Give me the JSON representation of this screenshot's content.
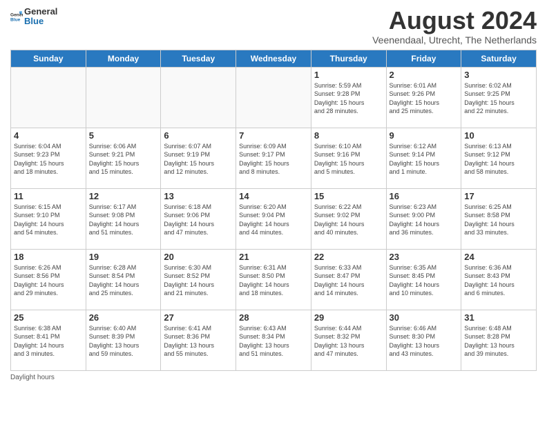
{
  "header": {
    "logo_general": "General",
    "logo_blue": "Blue",
    "month_title": "August 2024",
    "location": "Veenendaal, Utrecht, The Netherlands"
  },
  "weekdays": [
    "Sunday",
    "Monday",
    "Tuesday",
    "Wednesday",
    "Thursday",
    "Friday",
    "Saturday"
  ],
  "footer": {
    "label": "Daylight hours"
  },
  "weeks": [
    [
      {
        "day": "",
        "info": ""
      },
      {
        "day": "",
        "info": ""
      },
      {
        "day": "",
        "info": ""
      },
      {
        "day": "",
        "info": ""
      },
      {
        "day": "1",
        "info": "Sunrise: 5:59 AM\nSunset: 9:28 PM\nDaylight: 15 hours\nand 28 minutes."
      },
      {
        "day": "2",
        "info": "Sunrise: 6:01 AM\nSunset: 9:26 PM\nDaylight: 15 hours\nand 25 minutes."
      },
      {
        "day": "3",
        "info": "Sunrise: 6:02 AM\nSunset: 9:25 PM\nDaylight: 15 hours\nand 22 minutes."
      }
    ],
    [
      {
        "day": "4",
        "info": "Sunrise: 6:04 AM\nSunset: 9:23 PM\nDaylight: 15 hours\nand 18 minutes."
      },
      {
        "day": "5",
        "info": "Sunrise: 6:06 AM\nSunset: 9:21 PM\nDaylight: 15 hours\nand 15 minutes."
      },
      {
        "day": "6",
        "info": "Sunrise: 6:07 AM\nSunset: 9:19 PM\nDaylight: 15 hours\nand 12 minutes."
      },
      {
        "day": "7",
        "info": "Sunrise: 6:09 AM\nSunset: 9:17 PM\nDaylight: 15 hours\nand 8 minutes."
      },
      {
        "day": "8",
        "info": "Sunrise: 6:10 AM\nSunset: 9:16 PM\nDaylight: 15 hours\nand 5 minutes."
      },
      {
        "day": "9",
        "info": "Sunrise: 6:12 AM\nSunset: 9:14 PM\nDaylight: 15 hours\nand 1 minute."
      },
      {
        "day": "10",
        "info": "Sunrise: 6:13 AM\nSunset: 9:12 PM\nDaylight: 14 hours\nand 58 minutes."
      }
    ],
    [
      {
        "day": "11",
        "info": "Sunrise: 6:15 AM\nSunset: 9:10 PM\nDaylight: 14 hours\nand 54 minutes."
      },
      {
        "day": "12",
        "info": "Sunrise: 6:17 AM\nSunset: 9:08 PM\nDaylight: 14 hours\nand 51 minutes."
      },
      {
        "day": "13",
        "info": "Sunrise: 6:18 AM\nSunset: 9:06 PM\nDaylight: 14 hours\nand 47 minutes."
      },
      {
        "day": "14",
        "info": "Sunrise: 6:20 AM\nSunset: 9:04 PM\nDaylight: 14 hours\nand 44 minutes."
      },
      {
        "day": "15",
        "info": "Sunrise: 6:22 AM\nSunset: 9:02 PM\nDaylight: 14 hours\nand 40 minutes."
      },
      {
        "day": "16",
        "info": "Sunrise: 6:23 AM\nSunset: 9:00 PM\nDaylight: 14 hours\nand 36 minutes."
      },
      {
        "day": "17",
        "info": "Sunrise: 6:25 AM\nSunset: 8:58 PM\nDaylight: 14 hours\nand 33 minutes."
      }
    ],
    [
      {
        "day": "18",
        "info": "Sunrise: 6:26 AM\nSunset: 8:56 PM\nDaylight: 14 hours\nand 29 minutes."
      },
      {
        "day": "19",
        "info": "Sunrise: 6:28 AM\nSunset: 8:54 PM\nDaylight: 14 hours\nand 25 minutes."
      },
      {
        "day": "20",
        "info": "Sunrise: 6:30 AM\nSunset: 8:52 PM\nDaylight: 14 hours\nand 21 minutes."
      },
      {
        "day": "21",
        "info": "Sunrise: 6:31 AM\nSunset: 8:50 PM\nDaylight: 14 hours\nand 18 minutes."
      },
      {
        "day": "22",
        "info": "Sunrise: 6:33 AM\nSunset: 8:47 PM\nDaylight: 14 hours\nand 14 minutes."
      },
      {
        "day": "23",
        "info": "Sunrise: 6:35 AM\nSunset: 8:45 PM\nDaylight: 14 hours\nand 10 minutes."
      },
      {
        "day": "24",
        "info": "Sunrise: 6:36 AM\nSunset: 8:43 PM\nDaylight: 14 hours\nand 6 minutes."
      }
    ],
    [
      {
        "day": "25",
        "info": "Sunrise: 6:38 AM\nSunset: 8:41 PM\nDaylight: 14 hours\nand 3 minutes."
      },
      {
        "day": "26",
        "info": "Sunrise: 6:40 AM\nSunset: 8:39 PM\nDaylight: 13 hours\nand 59 minutes."
      },
      {
        "day": "27",
        "info": "Sunrise: 6:41 AM\nSunset: 8:36 PM\nDaylight: 13 hours\nand 55 minutes."
      },
      {
        "day": "28",
        "info": "Sunrise: 6:43 AM\nSunset: 8:34 PM\nDaylight: 13 hours\nand 51 minutes."
      },
      {
        "day": "29",
        "info": "Sunrise: 6:44 AM\nSunset: 8:32 PM\nDaylight: 13 hours\nand 47 minutes."
      },
      {
        "day": "30",
        "info": "Sunrise: 6:46 AM\nSunset: 8:30 PM\nDaylight: 13 hours\nand 43 minutes."
      },
      {
        "day": "31",
        "info": "Sunrise: 6:48 AM\nSunset: 8:28 PM\nDaylight: 13 hours\nand 39 minutes."
      }
    ]
  ]
}
